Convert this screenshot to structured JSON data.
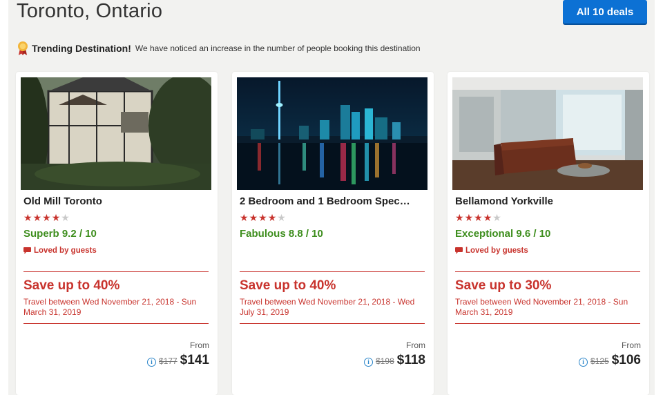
{
  "header": {
    "city_title": "Toronto, Ontario",
    "deals_button": "All 10 deals"
  },
  "trending": {
    "icon": "award-ribbon-icon",
    "title": "Trending Destination!",
    "text": "We have noticed an increase in the number of people booking this destination"
  },
  "colors": {
    "accent_red": "#c8332d",
    "rating_green": "#3e8e1e",
    "button_blue": "#0c71d4"
  },
  "cards": [
    {
      "name": "Old Mill Toronto",
      "stars": 4,
      "rating": "Superb 9.2 / 10",
      "loved": "Loved by guests",
      "save": "Save up to 40%",
      "travel": "Travel between Wed November 21, 2018 - Sun March 31, 2019",
      "from": "From",
      "old_price": "$177",
      "price": "$141",
      "image": "tudor-style hotel building"
    },
    {
      "name": "2 Bedroom and 1 Bedroom Spec…",
      "stars": 4,
      "rating": "Fabulous 8.8 / 10",
      "loved": "",
      "save": "Save up to 40%",
      "travel": "Travel between Wed November 21, 2018 - Wed July 31, 2019",
      "from": "From",
      "old_price": "$198",
      "price": "$118",
      "image": "toronto skyline at night"
    },
    {
      "name": "Bellamond Yorkville",
      "stars": 4,
      "rating": "Exceptional 9.6 / 10",
      "loved": "Loved by guests",
      "save": "Save up to 30%",
      "travel": "Travel between Wed November 21, 2018 - Sun March 31, 2019",
      "from": "From",
      "old_price": "$125",
      "price": "$106",
      "image": "modern apartment living room"
    }
  ]
}
